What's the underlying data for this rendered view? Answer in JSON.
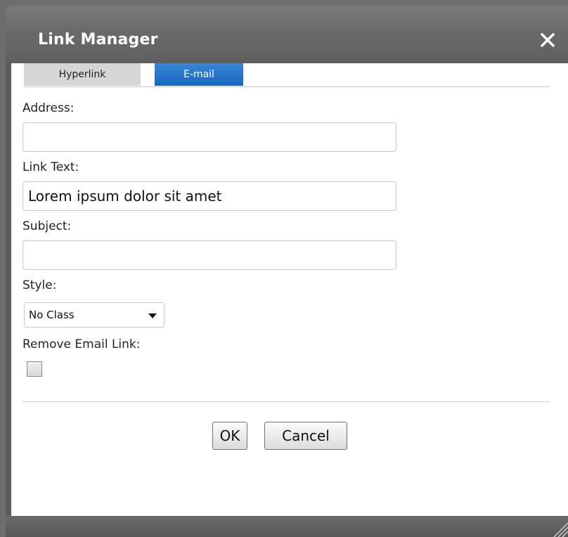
{
  "dialog": {
    "title": "Link Manager",
    "close_icon": "close-icon"
  },
  "tabs": [
    {
      "label": "Hyperlink",
      "active": false
    },
    {
      "label": "E-mail",
      "active": true
    }
  ],
  "form": {
    "address": {
      "label": "Address:",
      "value": ""
    },
    "link_text": {
      "label": "Link Text:",
      "value": "Lorem ipsum dolor sit amet"
    },
    "subject": {
      "label": "Subject:",
      "value": ""
    },
    "style": {
      "label": "Style:",
      "selected": "No Class"
    },
    "remove_link": {
      "label": "Remove Email Link:",
      "checked": false
    }
  },
  "buttons": {
    "ok": "OK",
    "cancel": "Cancel"
  },
  "colors": {
    "titlebar": "#6a6a6a",
    "active_tab": "#1767c0",
    "inactive_tab": "#d6d6d6"
  }
}
